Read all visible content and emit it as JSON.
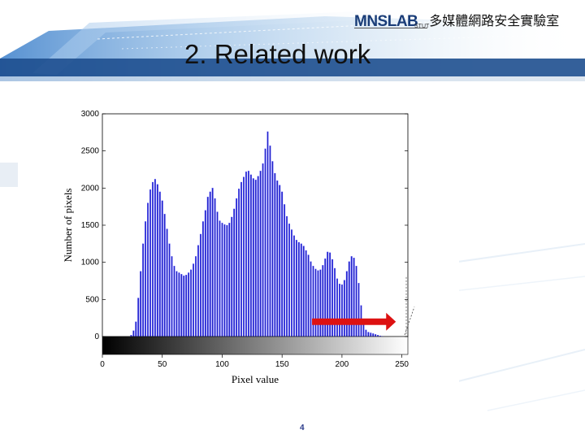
{
  "slide": {
    "title": "2. Related work",
    "page_number": "4",
    "logo_text": "MNSLAB",
    "logo_sub": "STUT",
    "lab_name": "多媒體網路安全實驗室",
    "colors": {
      "banner_blue": "#2f77c7",
      "logo_gold": "#c7b06a",
      "logo_navy": "#1a3d78"
    }
  },
  "chart_data": {
    "type": "bar",
    "title": "",
    "xlabel": "Pixel value",
    "ylabel": "Number of pixels",
    "xlim": [
      0,
      255
    ],
    "ylim": [
      0,
      3000
    ],
    "xticks": [
      0,
      50,
      100,
      150,
      200,
      250
    ],
    "yticks": [
      0,
      500,
      1000,
      1500,
      2000,
      2500,
      3000
    ],
    "bar_color": "#2020c8",
    "grayscale_colorbar": true,
    "x": [
      24,
      26,
      28,
      30,
      32,
      34,
      36,
      38,
      40,
      42,
      44,
      46,
      48,
      50,
      52,
      54,
      56,
      58,
      60,
      62,
      64,
      66,
      68,
      70,
      72,
      74,
      76,
      78,
      80,
      82,
      84,
      86,
      88,
      90,
      92,
      94,
      96,
      98,
      100,
      102,
      104,
      106,
      108,
      110,
      112,
      114,
      116,
      118,
      120,
      122,
      124,
      126,
      128,
      130,
      132,
      134,
      136,
      138,
      140,
      142,
      144,
      146,
      148,
      150,
      152,
      154,
      156,
      158,
      160,
      162,
      164,
      166,
      168,
      170,
      172,
      174,
      176,
      178,
      180,
      182,
      184,
      186,
      188,
      190,
      192,
      194,
      196,
      198,
      200,
      202,
      204,
      206,
      208,
      210,
      212,
      214,
      216,
      218,
      220,
      222,
      224,
      226,
      228,
      230,
      232,
      234
    ],
    "values": [
      20,
      80,
      200,
      520,
      880,
      1250,
      1550,
      1800,
      1980,
      2080,
      2120,
      2050,
      1950,
      1830,
      1650,
      1450,
      1250,
      1080,
      950,
      880,
      860,
      840,
      820,
      830,
      860,
      900,
      980,
      1080,
      1230,
      1380,
      1550,
      1700,
      1880,
      1950,
      2000,
      1860,
      1680,
      1560,
      1530,
      1510,
      1500,
      1530,
      1610,
      1720,
      1860,
      1990,
      2080,
      2150,
      2220,
      2230,
      2180,
      2130,
      2110,
      2160,
      2230,
      2330,
      2530,
      2760,
      2570,
      2360,
      2200,
      2100,
      2040,
      1950,
      1780,
      1620,
      1520,
      1440,
      1360,
      1300,
      1270,
      1250,
      1220,
      1160,
      1100,
      1010,
      950,
      910,
      890,
      900,
      960,
      1050,
      1140,
      1130,
      1040,
      920,
      780,
      710,
      700,
      760,
      880,
      1010,
      1080,
      1060,
      950,
      720,
      420,
      180,
      90,
      60,
      50,
      40,
      30,
      20,
      10,
      5
    ],
    "annotation_arrow": {
      "from_x": 175,
      "to_x": 245,
      "y": 200,
      "color": "#dd1111"
    }
  }
}
